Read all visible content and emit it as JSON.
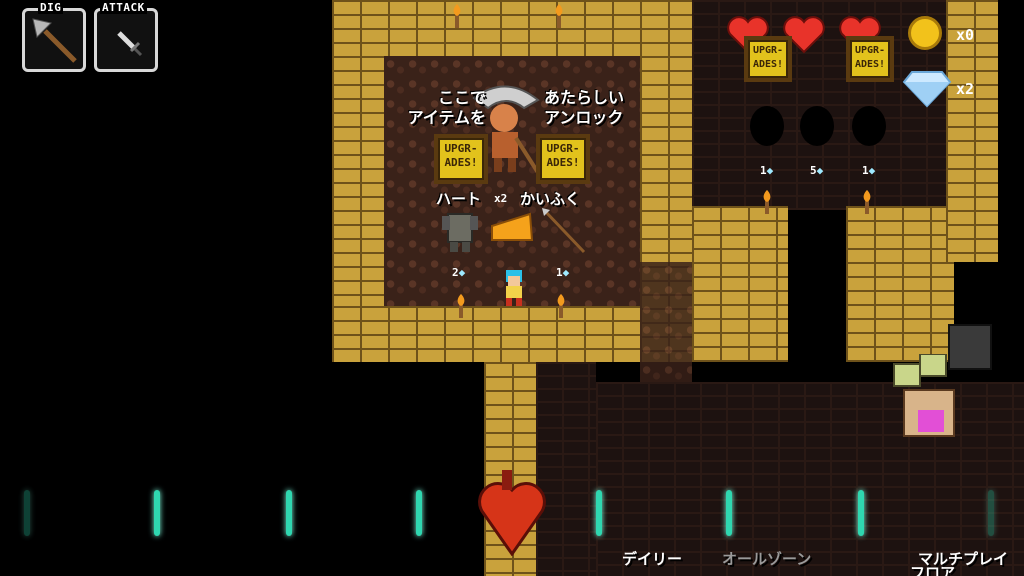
{
  "hud": {
    "slots": [
      {
        "label": "DIG",
        "icon": "shovel-icon"
      },
      {
        "label": "ATTACK",
        "icon": "dagger-icon"
      }
    ],
    "hearts": 3,
    "gold_count": "x0",
    "diamond_count": "x2"
  },
  "shop": {
    "left_text": "ここで\nアイテムを",
    "right_text": "あたらしい\nアンロック",
    "sign_text": "UPGR-\nADES!",
    "item_labels": {
      "heart": "ハート",
      "heart_mult": "x2",
      "armor": "かいふく"
    },
    "prices": {
      "armor_left": "2",
      "weapon_right": "1"
    },
    "right_prices": [
      "1",
      "5",
      "1"
    ]
  },
  "menu": {
    "daily": "デイリー",
    "allzones": "オールゾーン",
    "multi": "マルチプレイ",
    "floor": "フロア"
  },
  "colors": {
    "brick": "#c9a23c",
    "beat": "#2fd7b0",
    "heart": "#e8332a"
  }
}
